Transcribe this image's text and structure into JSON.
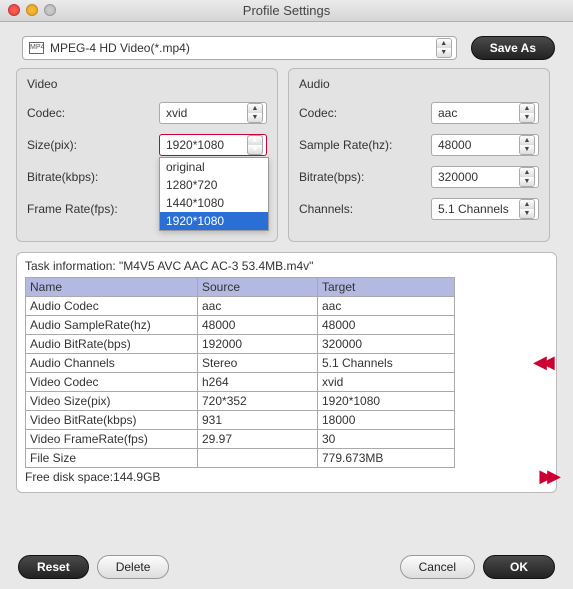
{
  "window": {
    "title": "Profile Settings"
  },
  "profile": {
    "icon_label": "MP4",
    "selected": "MPEG-4 HD Video(*.mp4)",
    "save_as": "Save As"
  },
  "video": {
    "title": "Video",
    "codec_label": "Codec:",
    "codec_value": "xvid",
    "size_label": "Size(pix):",
    "size_value": "1920*1080",
    "size_options": [
      "original",
      "1280*720",
      "1440*1080",
      "1920*1080"
    ],
    "bitrate_label": "Bitrate(kbps):",
    "bitrate_value": "",
    "framerate_label": "Frame Rate(fps):",
    "framerate_value": ""
  },
  "audio": {
    "title": "Audio",
    "codec_label": "Codec:",
    "codec_value": "aac",
    "samplerate_label": "Sample Rate(hz):",
    "samplerate_value": "48000",
    "bitrate_label": "Bitrate(bps):",
    "bitrate_value": "320000",
    "channels_label": "Channels:",
    "channels_value": "5.1 Channels"
  },
  "task": {
    "info_prefix": "Task information: ",
    "info_file": "\"M4V5 AVC AAC AC-3 53.4MB.m4v\"",
    "headers": [
      "Name",
      "Source",
      "Target"
    ],
    "rows": [
      [
        "Audio Codec",
        "aac",
        "aac"
      ],
      [
        "Audio SampleRate(hz)",
        "48000",
        "48000"
      ],
      [
        "Audio BitRate(bps)",
        "192000",
        "320000"
      ],
      [
        "Audio Channels",
        "Stereo",
        "5.1 Channels"
      ],
      [
        "Video Codec",
        "h264",
        "xvid"
      ],
      [
        "Video Size(pix)",
        "720*352",
        "1920*1080"
      ],
      [
        "Video BitRate(kbps)",
        "931",
        "18000"
      ],
      [
        "Video FrameRate(fps)",
        "29.97",
        "30"
      ],
      [
        "File Size",
        "",
        "779.673MB"
      ]
    ],
    "free_disk": "Free disk space:144.9GB"
  },
  "buttons": {
    "reset": "Reset",
    "delete": "Delete",
    "cancel": "Cancel",
    "ok": "OK"
  }
}
